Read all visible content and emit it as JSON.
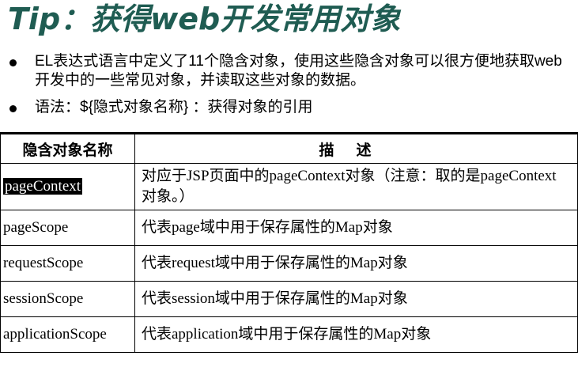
{
  "title": "Tip：获得web开发常用对象",
  "bullets": [
    "EL表达式语言中定义了11个隐含对象，使用这些隐含对象可以很方便地获取web开发中的一些常见对象，并读取这些对象的数据。",
    "语法：${隐式对象名称} ：获得对象的引用"
  ],
  "table": {
    "headers": [
      "隐含对象名称",
      "描述"
    ],
    "rows": [
      {
        "name": "pageContext",
        "desc": "对应于JSP页面中的pageContext对象（注意：取的是pageContext对象。）"
      },
      {
        "name": "pageScope",
        "desc": "代表page域中用于保存属性的Map对象"
      },
      {
        "name": "requestScope",
        "desc": "代表request域中用于保存属性的Map对象"
      },
      {
        "name": "sessionScope",
        "desc": "代表session域中用于保存属性的Map对象"
      },
      {
        "name": "applicationScope",
        "desc": "代表application域中用于保存属性的Map对象"
      }
    ]
  }
}
